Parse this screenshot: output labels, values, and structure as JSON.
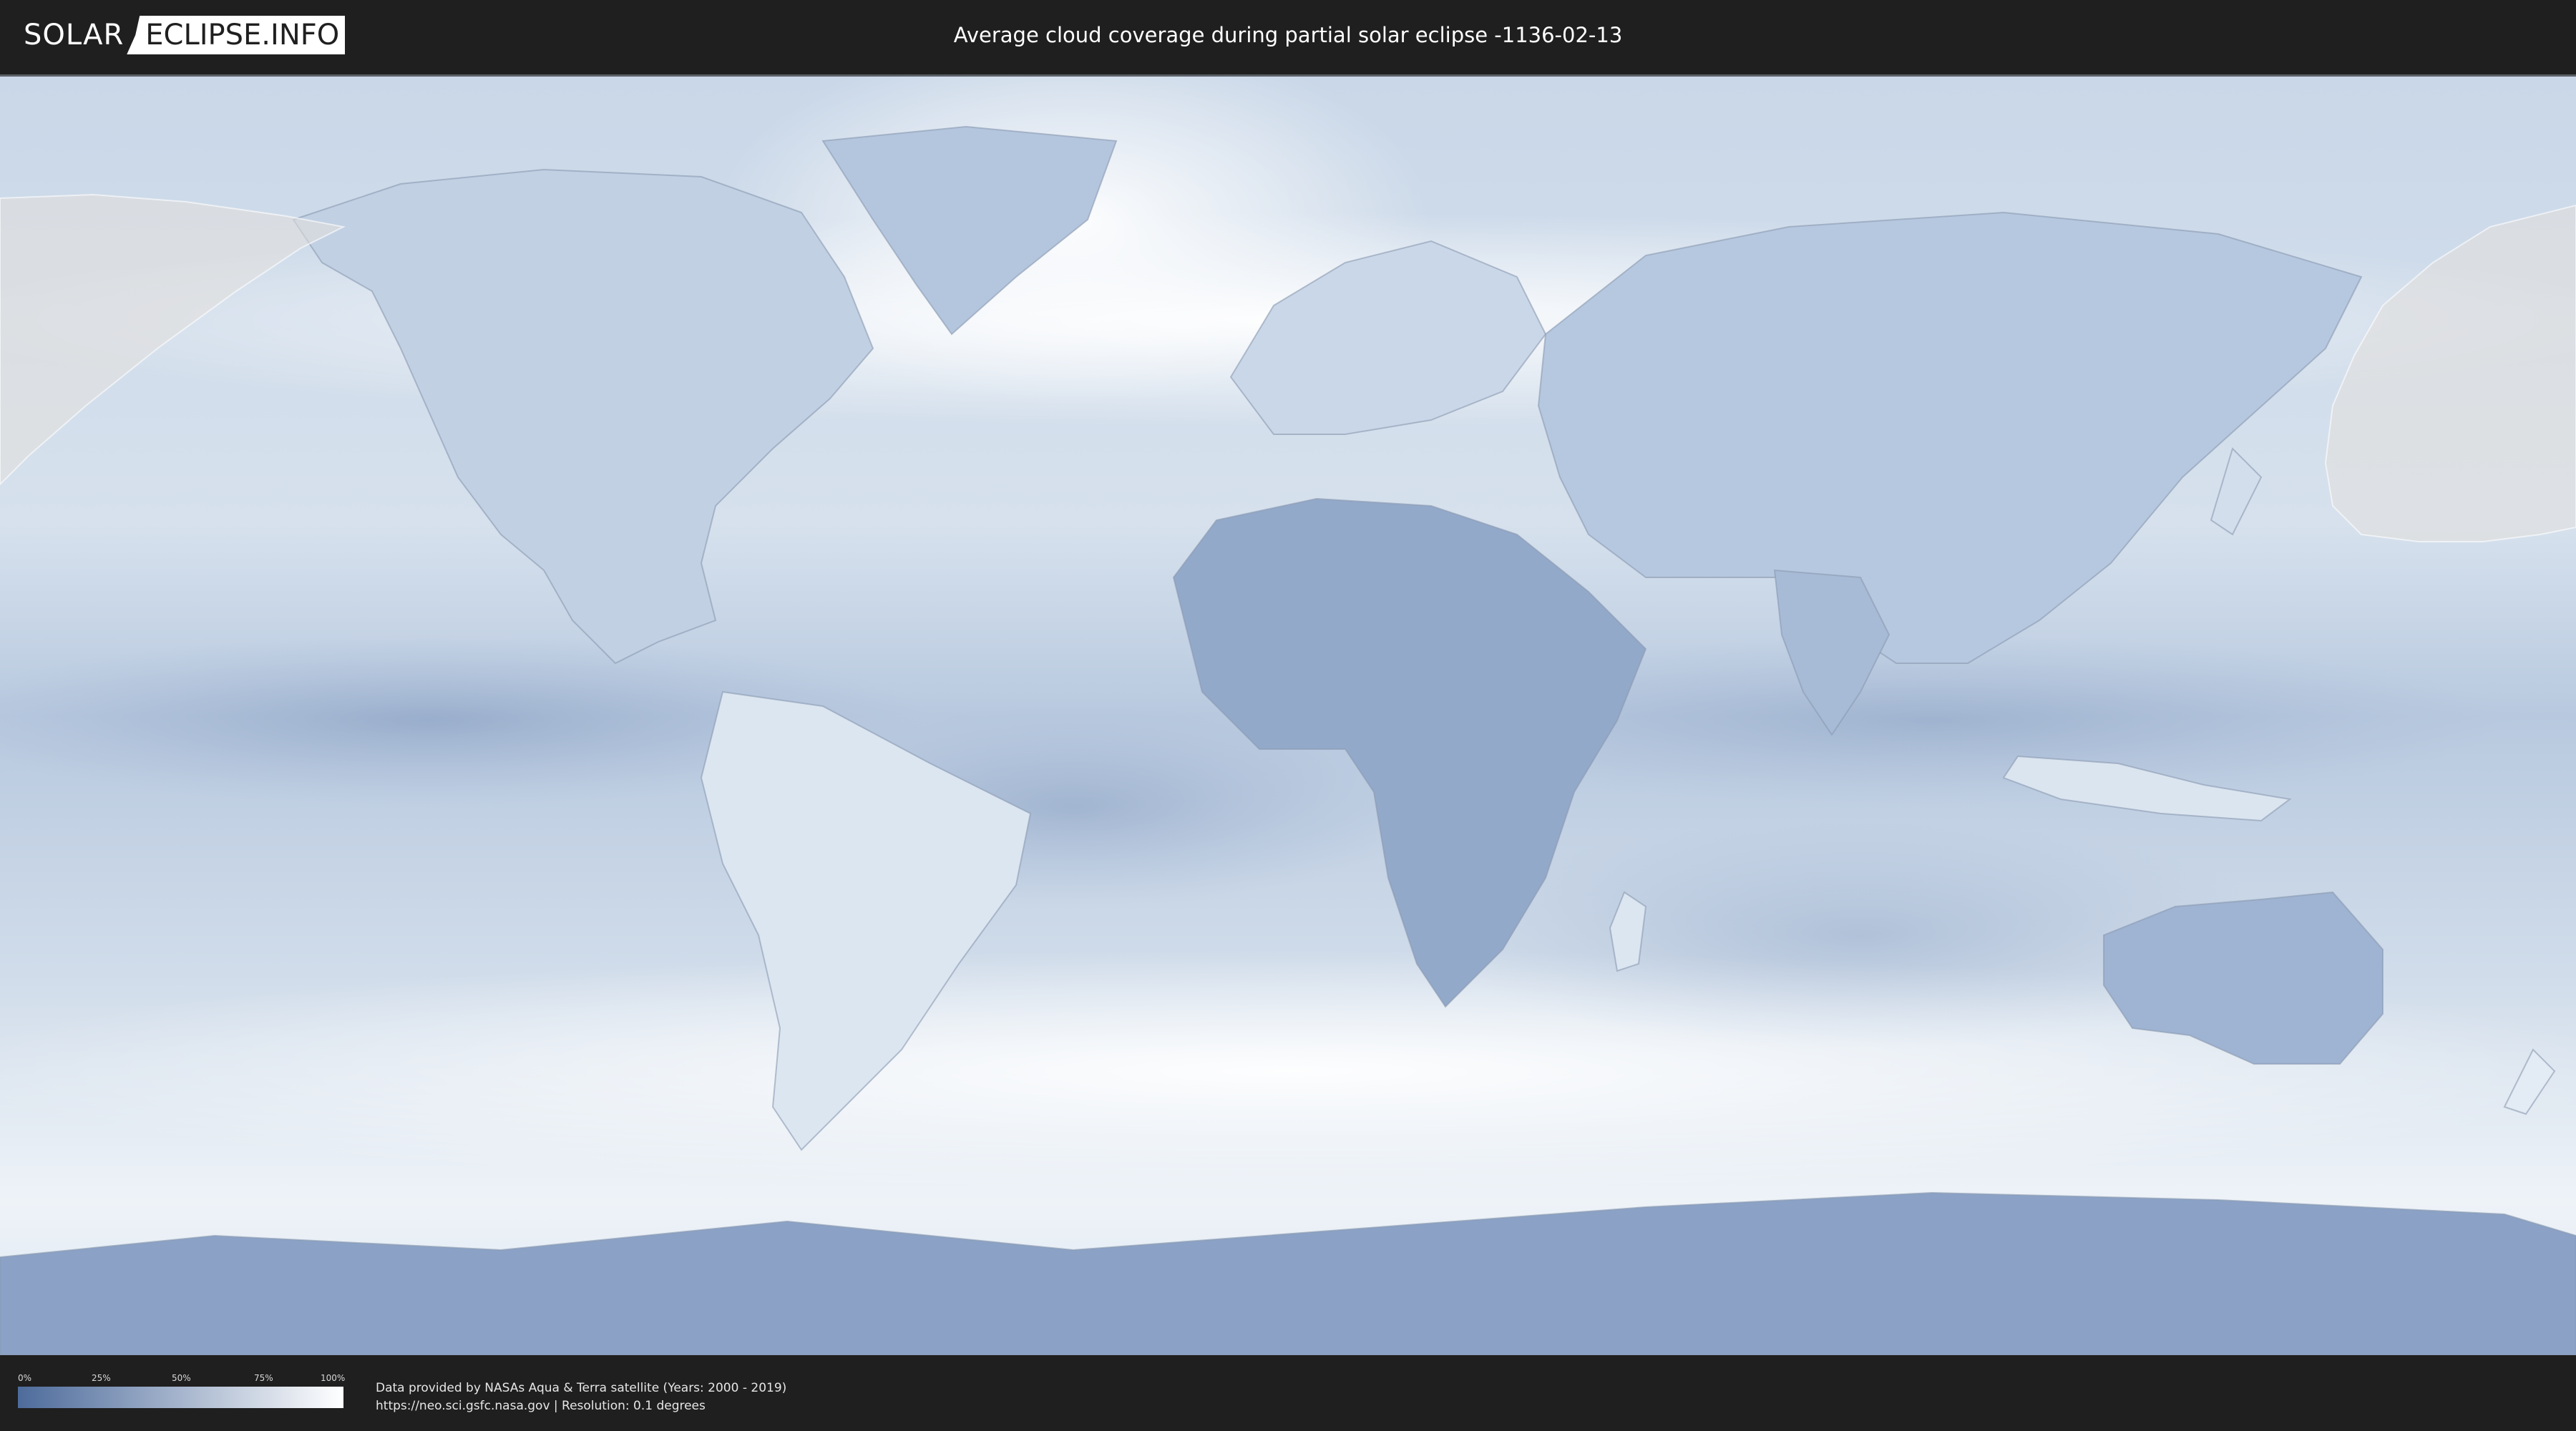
{
  "header": {
    "logo_left": "SOLAR",
    "logo_right": "ECLIPSE.INFO",
    "title": "Average cloud coverage during partial solar eclipse -1136-02-13"
  },
  "legend": {
    "ticks": [
      "0%",
      "25%",
      "50%",
      "75%",
      "100%"
    ],
    "colors": {
      "low": "#4d6b9b",
      "high": "#ffffff"
    }
  },
  "credits": {
    "line1": "Data provided by NASAs Aqua & Terra satellite (Years: 2000 - 2019)",
    "line2": "https://neo.sci.gsfc.nasa.gov | Resolution: 0.1 degrees"
  },
  "map": {
    "colors": {
      "ocean": "#cdd9e7",
      "clear_sky": "#7f97bd",
      "cloudy": "#ffffff",
      "eclipse_zone": "#e3e0dc",
      "frame": "#5b5f66"
    }
  }
}
